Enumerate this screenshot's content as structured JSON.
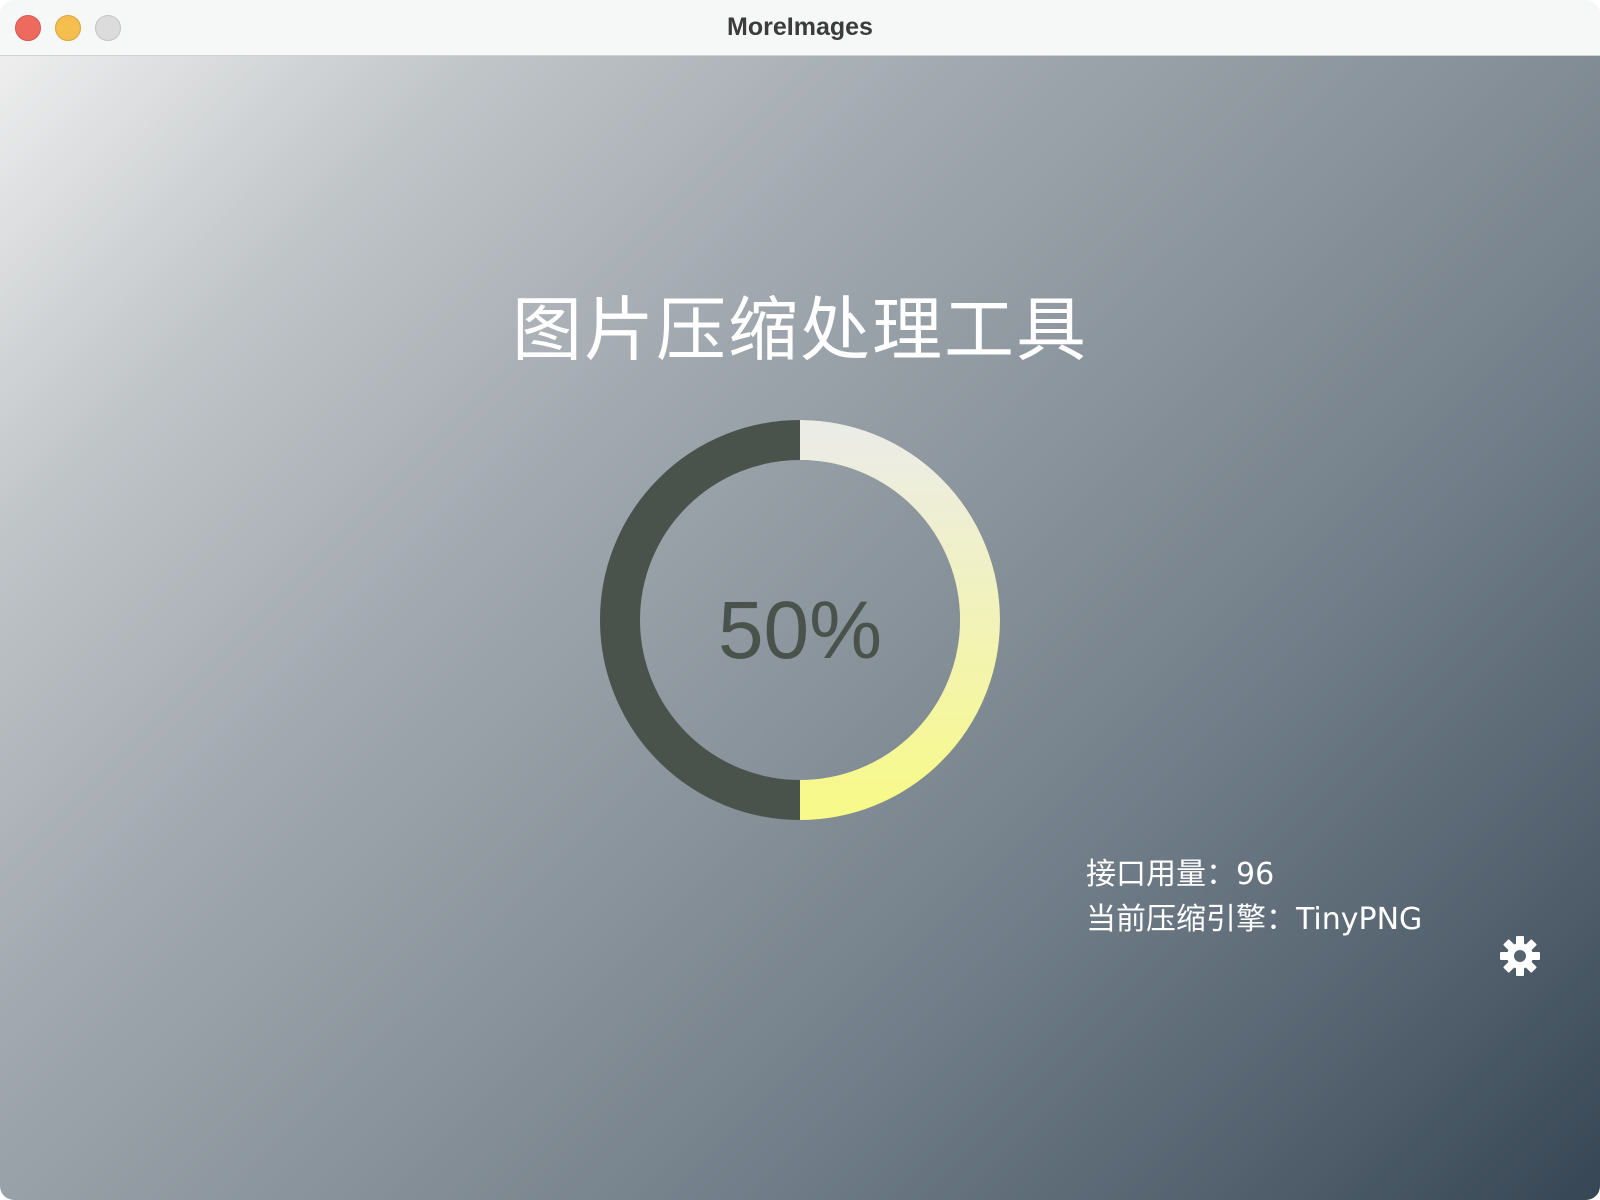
{
  "window": {
    "title": "MoreImages"
  },
  "app": {
    "title": "图片压缩处理工具"
  },
  "progress": {
    "value": 0.5,
    "label": "50%",
    "track_color": "#4a524c",
    "fill_color_start": "#ecece6",
    "fill_color_end": "#f7f98a"
  },
  "info": {
    "api_usage_label": "接口用量：",
    "api_usage_value": "96",
    "engine_label": "当前压缩引擎：",
    "engine_value": "TinyPNG"
  },
  "icons": {
    "settings": "gear-icon"
  }
}
